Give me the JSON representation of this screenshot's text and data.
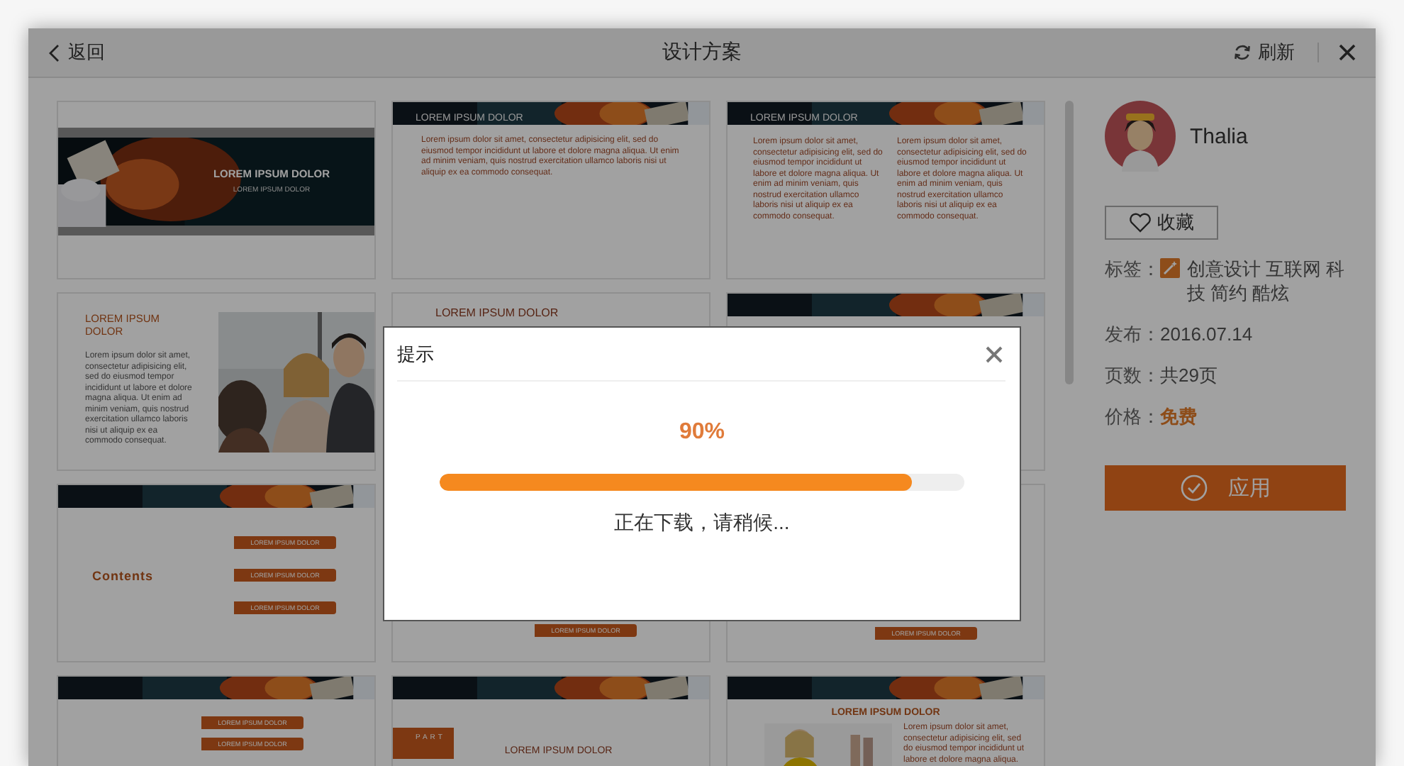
{
  "window": {
    "back": "返回",
    "title": "设计方案",
    "refresh": "刷新"
  },
  "slides": [
    {
      "kind": "cover",
      "banner": false,
      "title": "LOREM IPSUM DOLOR",
      "subtitle": "LOREM IPSUM DOLOR"
    },
    {
      "kind": "text",
      "banner": true,
      "header": "LOREM IPSUM DOLOR",
      "paragraphs": [
        "Lorem ipsum dolor sit amet, consectetur adipisicing elit, sed do eiusmod tempor incididunt ut labore et dolore magna aliqua. Ut enim ad minim veniam, quis nostrud exercitation ullamco laboris nisi ut aliquip ex ea commodo consequat."
      ]
    },
    {
      "kind": "columns",
      "banner": true,
      "header": "LOREM IPSUM DOLOR",
      "paragraphs": [
        "Lorem ipsum dolor sit amet, consectetur adipisicing elit, sed do eiusmod tempor incididunt ut labore et dolore magna aliqua. Ut enim ad minim veniam, quis nostrud exercitation ullamco laboris nisi ut aliquip ex ea commodo consequat.",
        "Lorem ipsum dolor sit amet, consectetur adipisicing elit, sed do eiusmod tempor incididunt ut labore et dolore magna aliqua. Ut enim ad minim veniam, quis nostrud exercitation ullamco laboris nisi ut aliquip ex ea commodo consequat."
      ]
    },
    {
      "banner": false,
      "title": "LOREM IPSUM DOLOR",
      "paragraphs": [
        "Lorem ipsum dolor sit amet, consectetur adipisicing elit, sed do eiusmod tempor incididunt ut labore et dolore magna aliqua. Ut enim ad minim veniam, quis nostrud exercitation ullamco laboris nisi ut aliquip ex ea commodo consequat."
      ]
    },
    {
      "kind": "title",
      "banner": false,
      "title": "LOREM IPSUM DOLOR"
    },
    {
      "kind": "blank",
      "banner": true
    },
    {
      "kind": "contents",
      "banner": true,
      "title": "Contents",
      "items": [
        "LOREM IPSUM DOLOR",
        "LOREM IPSUM DOLOR",
        "LOREM IPSUM DOLOR"
      ]
    },
    {
      "kind": "lower-item",
      "banner": false,
      "items": [
        "LOREM IPSUM DOLOR"
      ]
    },
    {
      "kind": "lower-item",
      "banner": false,
      "items": [
        "LOREM IPSUM DOLOR"
      ]
    },
    {
      "kind": "items",
      "banner": true,
      "items": [
        "LOREM IPSUM DOLOR",
        "LOREM IPSUM DOLOR"
      ]
    },
    {
      "kind": "part",
      "banner": true,
      "label": "PART",
      "title": "LOREM IPSUM DOLOR"
    },
    {
      "kind": "photo-text",
      "banner": true,
      "title": "LOREM IPSUM DOLOR",
      "paragraphs": [
        "Lorem ipsum dolor sit amet, consectetur adipisicing elit, sed do eiusmod tempor incididunt ut labore et dolore magna aliqua."
      ]
    }
  ],
  "author": {
    "name": "Thalia"
  },
  "favorite": {
    "label": "收藏"
  },
  "details": [
    {
      "label": "标签：",
      "kind": "tags",
      "value": "创意设计 互联网 科技 简约 酷炫"
    },
    {
      "label": "发布：",
      "kind": "plain",
      "value": "2016.07.14"
    },
    {
      "label": "页数：",
      "kind": "plain",
      "value": "共29页"
    },
    {
      "label": "价格：",
      "kind": "price",
      "value": "免费"
    }
  ],
  "apply_button": {
    "label": "应用"
  },
  "dialog": {
    "title": "提示",
    "percent": "90%",
    "progress": {
      "level": 0.9
    },
    "message": "正在下载，请稍候..."
  }
}
